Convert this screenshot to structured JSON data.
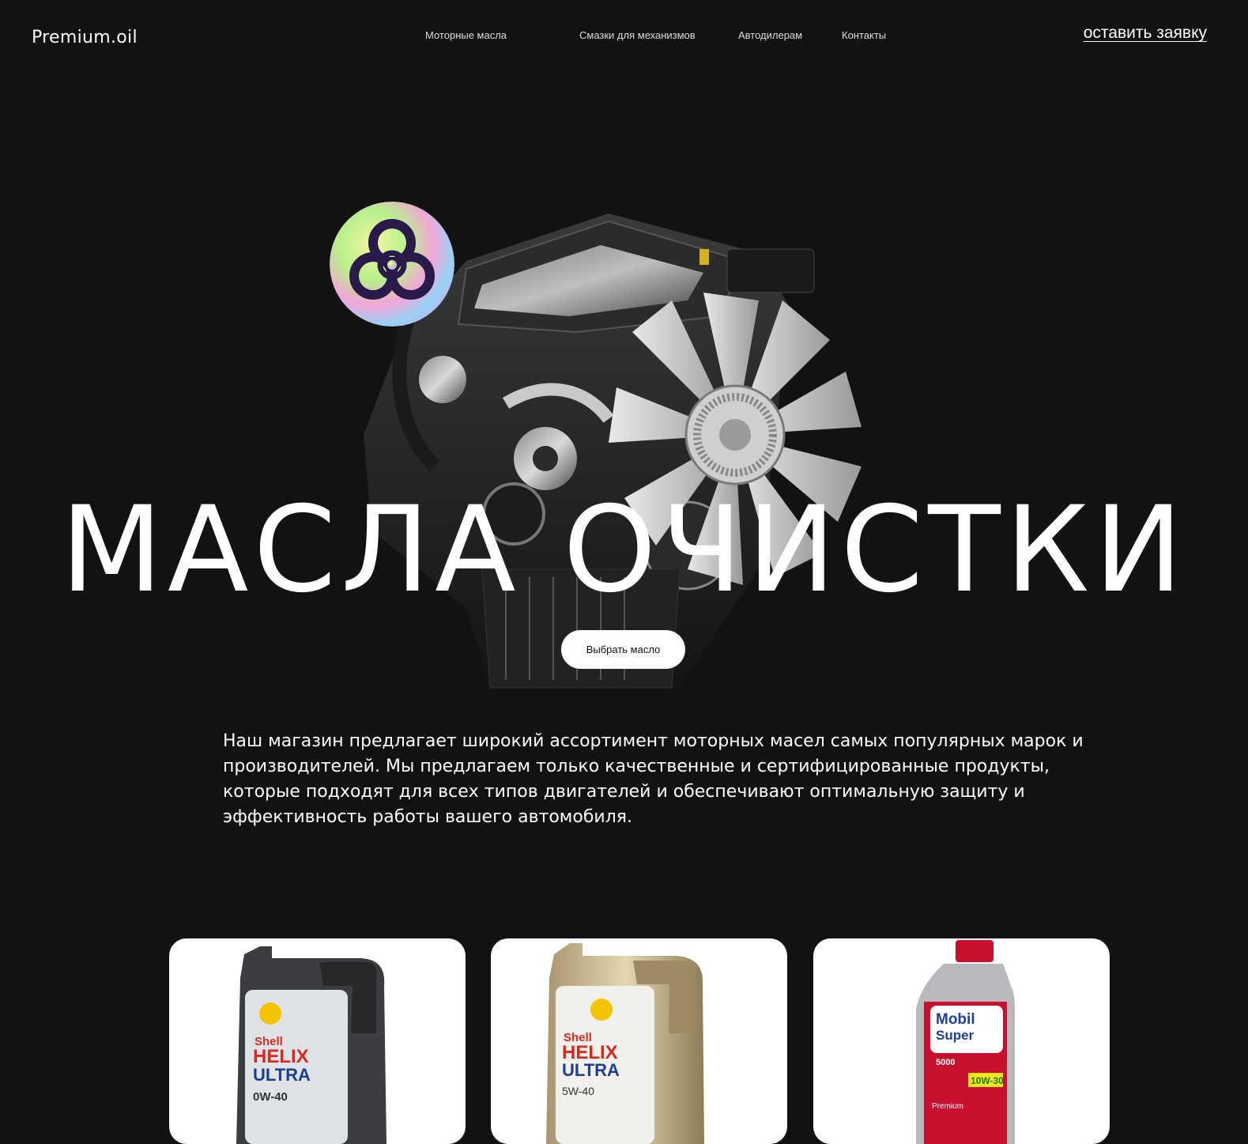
{
  "header": {
    "logo": "Premium.oil",
    "nav": [
      {
        "label": "Моторные масла"
      },
      {
        "label": "Смазки для механизмов"
      },
      {
        "label": "Автодилерам"
      },
      {
        "label": "Контакты"
      }
    ],
    "cta": "оставить заявку"
  },
  "hero": {
    "title": "МАСЛА ОЧИСТКИ",
    "button": "Выбрать масло",
    "description": "Наш магазин предлагает широкий ассортимент моторных масел самых популярных марок и производителей. Мы предлагаем только качественные и сертифицированные продукты, которые подходят для всех типов двигателей и обеспечивают оптимальную защиту и эффективность работы вашего автомобиля.",
    "image": "engine-with-fan",
    "badge_icon": "biohazard-icon"
  },
  "products": [
    {
      "brand": "Shell",
      "line1": "HELIX",
      "line2": "ULTRA",
      "grade": "0W-40",
      "image": "shell-helix-ultra-grey-canister"
    },
    {
      "brand": "Shell",
      "line1": "HELIX",
      "line2": "ULTRA",
      "grade": "5W-40",
      "image": "shell-helix-ultra-gold-canister"
    },
    {
      "brand": "Mobil",
      "line1": "Super",
      "line2": "5000",
      "grade": "10W-30",
      "extra": "Premium",
      "image": "mobil-super-bottle"
    }
  ],
  "colors": {
    "background": "#121212",
    "text": "#ffffff",
    "card": "#ffffff",
    "shell_red": "#d62a20",
    "shell_yellow": "#f5c400",
    "mobil_red": "#c8102e",
    "mobil_blue": "#1c3f94"
  }
}
